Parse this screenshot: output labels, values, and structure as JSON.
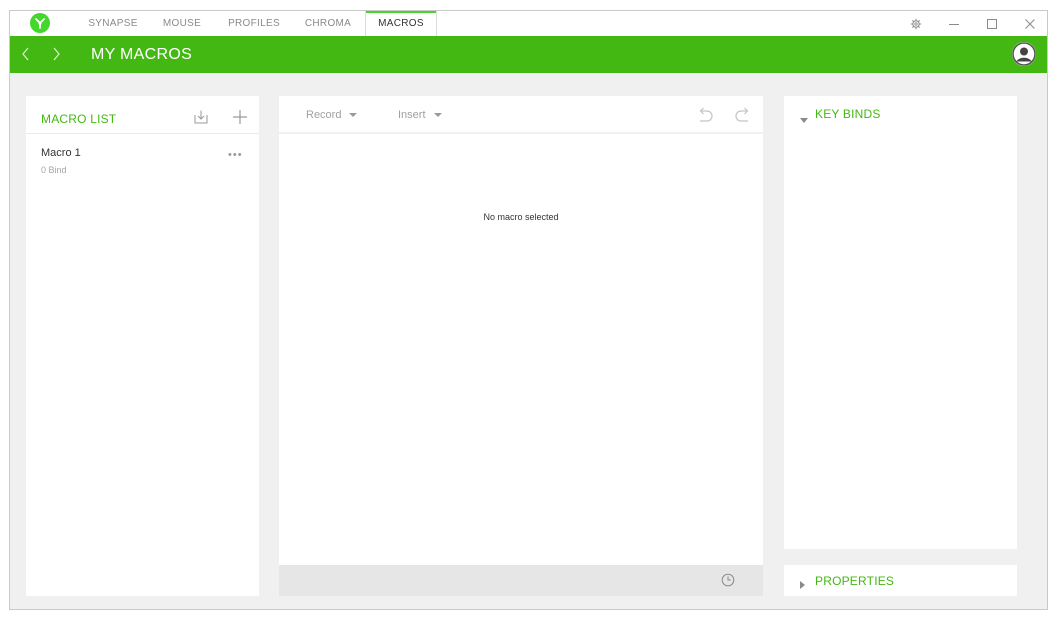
{
  "nav": {
    "tabs": [
      {
        "label": "SYNAPSE",
        "active": false
      },
      {
        "label": "MOUSE",
        "active": false
      },
      {
        "label": "PROFILES",
        "active": false
      },
      {
        "label": "CHROMA",
        "active": false
      },
      {
        "label": "MACROS",
        "active": true
      }
    ]
  },
  "header": {
    "title": "MY MACROS"
  },
  "macro_list": {
    "title": "MACRO LIST",
    "items": [
      {
        "name": "Macro 1",
        "binds": "0 Bind",
        "more": "•••"
      }
    ]
  },
  "editor": {
    "record_label": "Record",
    "insert_label": "Insert",
    "empty_message": "No macro selected"
  },
  "right_panel": {
    "key_binds_title": "KEY BINDS",
    "properties_title": "PROPERTIES"
  },
  "colors": {
    "accent": "#44b812",
    "logo": "#44d62c",
    "background": "#f0f0f0"
  },
  "icons": {
    "logo": "razer-logo-icon",
    "settings": "gear-icon",
    "minimize": "minimize-icon",
    "maximize": "maximize-icon",
    "close": "close-icon",
    "back": "chevron-left-icon",
    "forward": "chevron-right-icon",
    "avatar": "user-avatar-icon",
    "import": "import-icon",
    "add": "plus-icon",
    "undo": "undo-icon",
    "redo": "redo-icon",
    "delay": "clock-icon"
  }
}
